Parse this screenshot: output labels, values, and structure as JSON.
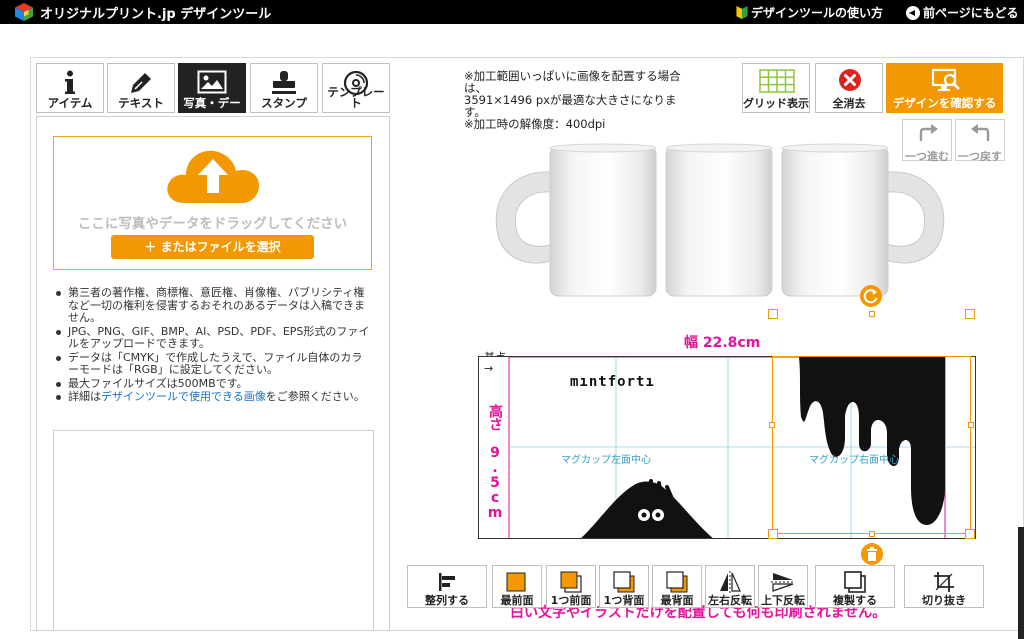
{
  "header": {
    "brand": "オリジナルプリント.jp デザインツール",
    "guide_link": "デザインツールの使い方",
    "back_link": "前ページにもどる"
  },
  "tabs": [
    {
      "label": "アイテム",
      "icon": "info-icon",
      "active": false
    },
    {
      "label": "テキスト",
      "icon": "pen-icon",
      "active": false
    },
    {
      "label": "写真・デー",
      "icon": "image-icon",
      "active": true
    },
    {
      "label": "スタンプ",
      "icon": "stamp-icon",
      "active": false
    },
    {
      "label": "テンプレート",
      "icon": "disc-icon",
      "active": false
    }
  ],
  "upload": {
    "drop_text": "ここに写真やデータをドラッグしてください",
    "file_button": "＋ またはファイルを選択"
  },
  "notes": [
    "第三者の著作権、商標権、意匠権、肖像権、パブリシティ権など一切の権利を侵害するおそれのあるデータは入稿できません。",
    "JPG、PNG、GIF、BMP、AI、PSD、PDF、EPS形式のファイルをアップロードできます。",
    "データは「CMYK」で作成したうえで、ファイル自体のカラーモードは「RGB」に設定してください。",
    "最大ファイルサイズは500MBです。"
  ],
  "notes_link": {
    "prefix": "詳細は",
    "link": "デザインツールで使用できる画像",
    "suffix": "をご参照ください。"
  },
  "info": [
    "※加工範囲いっぱいに画像を配置する場合は、",
    "3591×1496 pxが最適な大きさになります。",
    "※加工時の解像度：400dpi"
  ],
  "top_buttons": {
    "grid": "グリッド表示",
    "clear": "全消去",
    "confirm": "デザインを確認する",
    "redo": "一つ進む",
    "undo": "一つ戻す"
  },
  "canvas": {
    "width_label": "幅 22.8cm",
    "height_label": "高さ 9.5cm",
    "origin_label": "基点",
    "origin_arrow": "→",
    "left_center": "マグカップ左面中心",
    "right_center": "マグカップ右面中心",
    "design_text": "mıntfortı"
  },
  "bottom_buttons": [
    {
      "label": "整列する",
      "icon": "align-icon"
    },
    {
      "label": "最前面",
      "icon": "bring-front-icon"
    },
    {
      "label": "1つ前面",
      "icon": "bring-forward-icon"
    },
    {
      "label": "1つ背面",
      "icon": "send-backward-icon"
    },
    {
      "label": "最背面",
      "icon": "send-back-icon"
    },
    {
      "label": "左右反転",
      "icon": "flip-horizontal-icon"
    },
    {
      "label": "上下反転",
      "icon": "flip-vertical-icon"
    },
    {
      "label": "複製する",
      "icon": "duplicate-icon"
    },
    {
      "label": "切り抜き",
      "icon": "crop-icon"
    }
  ],
  "warning": "白い文字やイラストだけを配置しても何も印刷されません。",
  "colors": {
    "accent": "#f39800",
    "magenta": "#e5139a",
    "link": "#1a73c8",
    "guide": "#3aa0c8"
  }
}
